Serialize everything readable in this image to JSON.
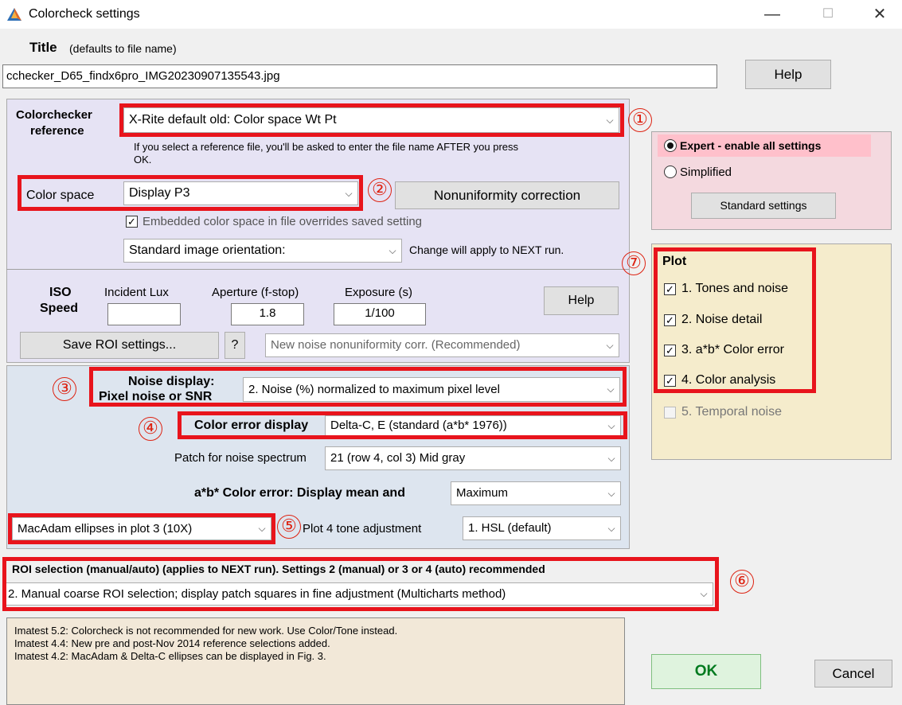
{
  "window": {
    "title": "Colorcheck settings",
    "minimize": "—",
    "maximize": "☐",
    "close": "✕"
  },
  "title_section": {
    "label": "Title",
    "hint": "(defaults to file name)",
    "value": "cchecker_D65_findx6pro_IMG20230907135543.jpg",
    "help": "Help"
  },
  "reference": {
    "label_line1": "Colorchecker",
    "label_line2": "reference",
    "selected": "X-Rite default old: Color space Wt Pt",
    "note_line1": "If you select a reference file, you'll be asked to enter the file name AFTER you press",
    "note_line2": "OK."
  },
  "color_space": {
    "label": "Color space",
    "selected": "Display P3",
    "nonuniformity_button": "Nonuniformity correction",
    "embedded_checkbox": "Embedded color space in file overrides saved setting",
    "orientation_selected": "Standard image orientation:",
    "orientation_note": "Change will apply to NEXT run."
  },
  "exposure": {
    "iso_line1": "ISO",
    "iso_line2": "Speed",
    "incident_lux_label": "Incident Lux",
    "incident_lux_value": "",
    "aperture_label": "Aperture (f-stop)",
    "aperture_value": "1.8",
    "exposure_label": "Exposure (s)",
    "exposure_value": "1/100",
    "help": "Help",
    "save_roi": "Save ROI settings...",
    "question": "?",
    "nonuniformity_selected": "New noise nonuniformity corr. (Recommended)"
  },
  "display": {
    "noise_label_line1": "Noise display:",
    "noise_label_line2": "Pixel noise or SNR",
    "noise_selected": "2. Noise (%) normalized to maximum pixel level",
    "color_error_label": "Color error display",
    "color_error_selected": "Delta-C, E (standard (a*b* 1976))",
    "patch_label": "Patch for noise spectrum",
    "patch_selected": "21  (row 4, col 3)  Mid gray",
    "ab_label": "a*b* Color error: Display mean and",
    "ab_selected": "Maximum",
    "ellipse_selected": "MacAdam ellipses in plot 3 (10X)",
    "tone_label": "Plot 4 tone adjustment",
    "tone_selected": "1. HSL (default)"
  },
  "roi": {
    "label": "ROI selection (manual/auto) (applies to NEXT run). Settings 2 (manual) or 3 or 4 (auto) recommended",
    "selected": "2. Manual coarse ROI selection; display patch squares in fine adjustment (Multicharts method)"
  },
  "mode": {
    "expert": "Expert - enable all settings",
    "simplified": "Simplified",
    "standard_settings": "Standard settings"
  },
  "plot": {
    "title": "Plot",
    "items": [
      {
        "label": "1. Tones and noise",
        "checked": true,
        "enabled": true
      },
      {
        "label": "2. Noise detail",
        "checked": true,
        "enabled": true
      },
      {
        "label": "3. a*b* Color error",
        "checked": true,
        "enabled": true
      },
      {
        "label": "4. Color analysis",
        "checked": true,
        "enabled": true
      },
      {
        "label": "5. Temporal noise",
        "checked": false,
        "enabled": false
      }
    ]
  },
  "notes": {
    "line1": "Imatest 5.2:  Colorcheck is not recommended for new work. Use Color/Tone instead.",
    "line2": "Imatest 4.4:  New pre and post-Nov 2014 reference selections added.",
    "line3": "Imatest 4.2:  MacAdam & Delta-C ellipses can be displayed in Fig. 3."
  },
  "actions": {
    "ok": "OK",
    "cancel": "Cancel"
  },
  "annotations": [
    "①",
    "②",
    "③",
    "④",
    "⑤",
    "⑥",
    "⑦"
  ],
  "colors": {
    "highlight_red": "#e8141c",
    "ok_green": "#007a1f"
  }
}
